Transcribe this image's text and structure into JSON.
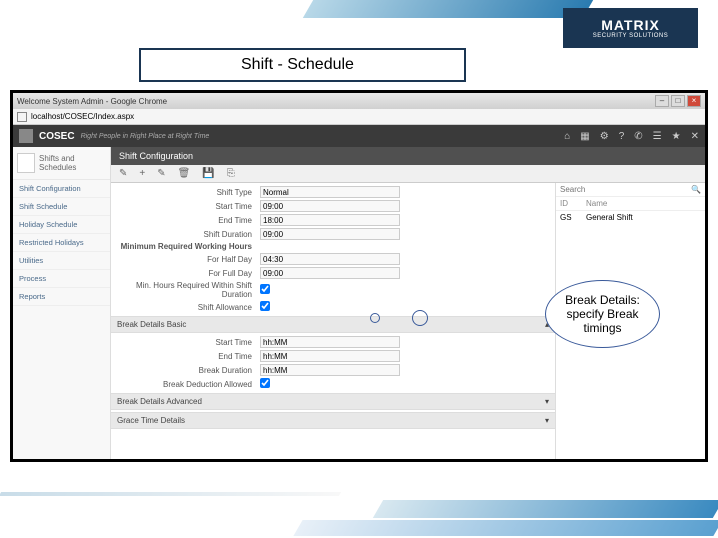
{
  "slide": {
    "title": "Shift - Schedule",
    "logo": {
      "name": "MATRIX",
      "sub": "SECURITY SOLUTIONS"
    },
    "callout": "Break Details: specify Break timings"
  },
  "browser": {
    "title": "Welcome System Admin - Google Chrome",
    "url": "localhost/COSEC/Index.aspx"
  },
  "app": {
    "brand": "COSEC",
    "tagline": "Right People in Right Place at Right Time",
    "header_icons": [
      "home-icon",
      "grid-icon",
      "gear-icon",
      "question-icon",
      "phone-icon",
      "user-icon"
    ],
    "panel_title": "Shift Configuration"
  },
  "sidebar": {
    "module_label": "Shifts and Schedules",
    "items": [
      "Shift Configuration",
      "Shift Schedule",
      "Holiday Schedule",
      "Restricted Holidays",
      "Utilities",
      "Process",
      "Reports"
    ]
  },
  "toolbar": {
    "icons": [
      "new",
      "plus",
      "edit",
      "delete",
      "save",
      "copy",
      "more"
    ]
  },
  "form": {
    "shift_type": {
      "label": "Shift Type",
      "value": "Normal"
    },
    "start_time": {
      "label": "Start Time",
      "value": "09:00"
    },
    "end_time": {
      "label": "End Time",
      "value": "18:00"
    },
    "shift_duration": {
      "label": "Shift Duration",
      "value": "09:00"
    },
    "min_heading": "Minimum Required Working Hours",
    "half_day": {
      "label": "For Half Day",
      "value": "04:30"
    },
    "full_day": {
      "label": "For Full Day",
      "value": "09:00"
    },
    "min_required": {
      "label": "Min. Hours Required Within Shift Duration",
      "checked": true
    },
    "shift_allowance": {
      "label": "Shift Allowance",
      "checked": true
    },
    "break_section": "Break Details Basic",
    "break_start": {
      "label": "Start Time",
      "value": "hh:MM"
    },
    "break_end": {
      "label": "End Time",
      "value": "hh:MM"
    },
    "break_duration": {
      "label": "Break Duration",
      "value": "hh:MM"
    },
    "break_deduct": {
      "label": "Break Deduction Allowed",
      "checked": true
    },
    "adv_section": "Break Details Advanced",
    "grace_section": "Grace Time Details"
  },
  "right_panel": {
    "search_placeholder": "Search",
    "col_id": "ID",
    "col_name": "Name",
    "row_id": "GS",
    "row_name": "General Shift"
  }
}
